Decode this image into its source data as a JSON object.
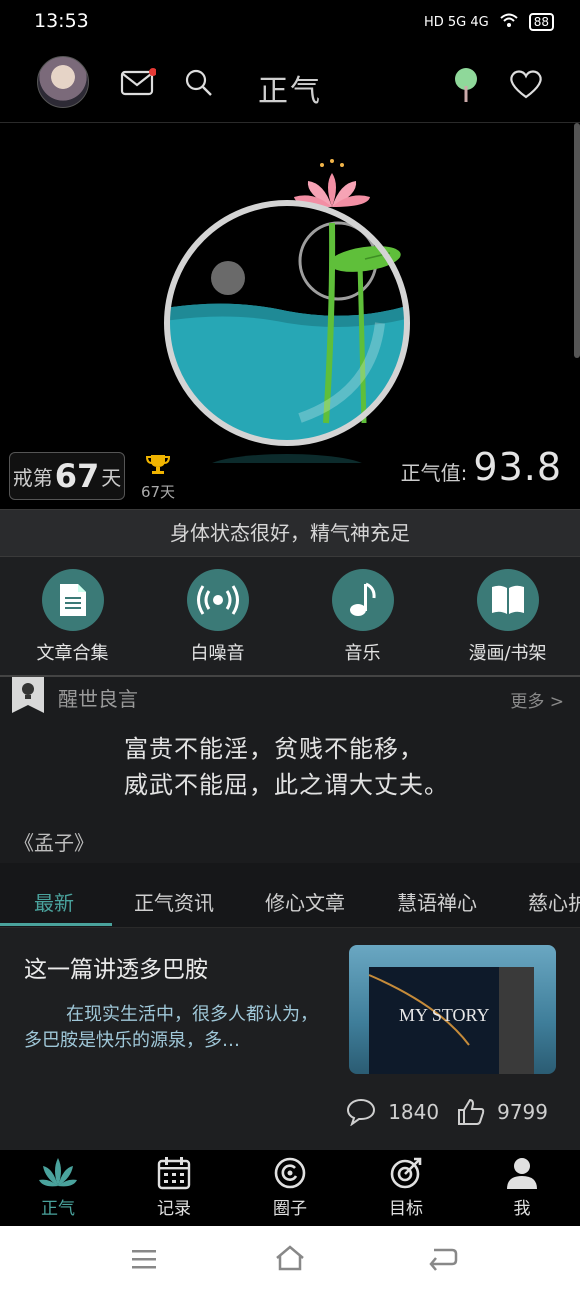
{
  "status_bar": {
    "time": "13:53",
    "network": "HD 5G 4G",
    "battery": "88"
  },
  "header": {
    "title": "正气"
  },
  "hero": {
    "streak_prefix": "戒第",
    "streak_days": "67",
    "streak_suffix": "天",
    "trophy_days": "67天",
    "score_label": "正气值:",
    "score_value": "93.8"
  },
  "status_line": "身体状态很好，精气神充足",
  "quick_menu": [
    {
      "label": "文章合集",
      "icon": "document-icon"
    },
    {
      "label": "白噪音",
      "icon": "broadcast-icon"
    },
    {
      "label": "音乐",
      "icon": "music-note-icon"
    },
    {
      "label": "漫画/书架",
      "icon": "book-icon"
    }
  ],
  "quote": {
    "heading": "醒世良言",
    "more": "更多 >",
    "line1": "富贵不能淫，贫贱不能移，",
    "line2": "威武不能屈，此之谓大丈夫。",
    "source": "《孟子》"
  },
  "tabs": [
    "最新",
    "正气资讯",
    "修心文章",
    "慧语禅心",
    "慈心护"
  ],
  "article": {
    "title": "这一篇讲透多巴胺",
    "desc": "在现实生活中，很多人都认为，多巴胺是快乐的源泉，多…",
    "thumb_text": "MY STORY",
    "comments": "1840",
    "likes": "9799"
  },
  "bottom_nav": [
    {
      "label": "正气",
      "icon": "lotus-icon"
    },
    {
      "label": "记录",
      "icon": "calendar-icon"
    },
    {
      "label": "圈子",
      "icon": "circle-icon"
    },
    {
      "label": "目标",
      "icon": "target-icon"
    },
    {
      "label": "我",
      "icon": "person-icon"
    }
  ],
  "colors": {
    "accent": "#4aa39d",
    "water": "#27a7b5",
    "lotus": "#f28fa4",
    "leaf": "#5fbf3a"
  }
}
